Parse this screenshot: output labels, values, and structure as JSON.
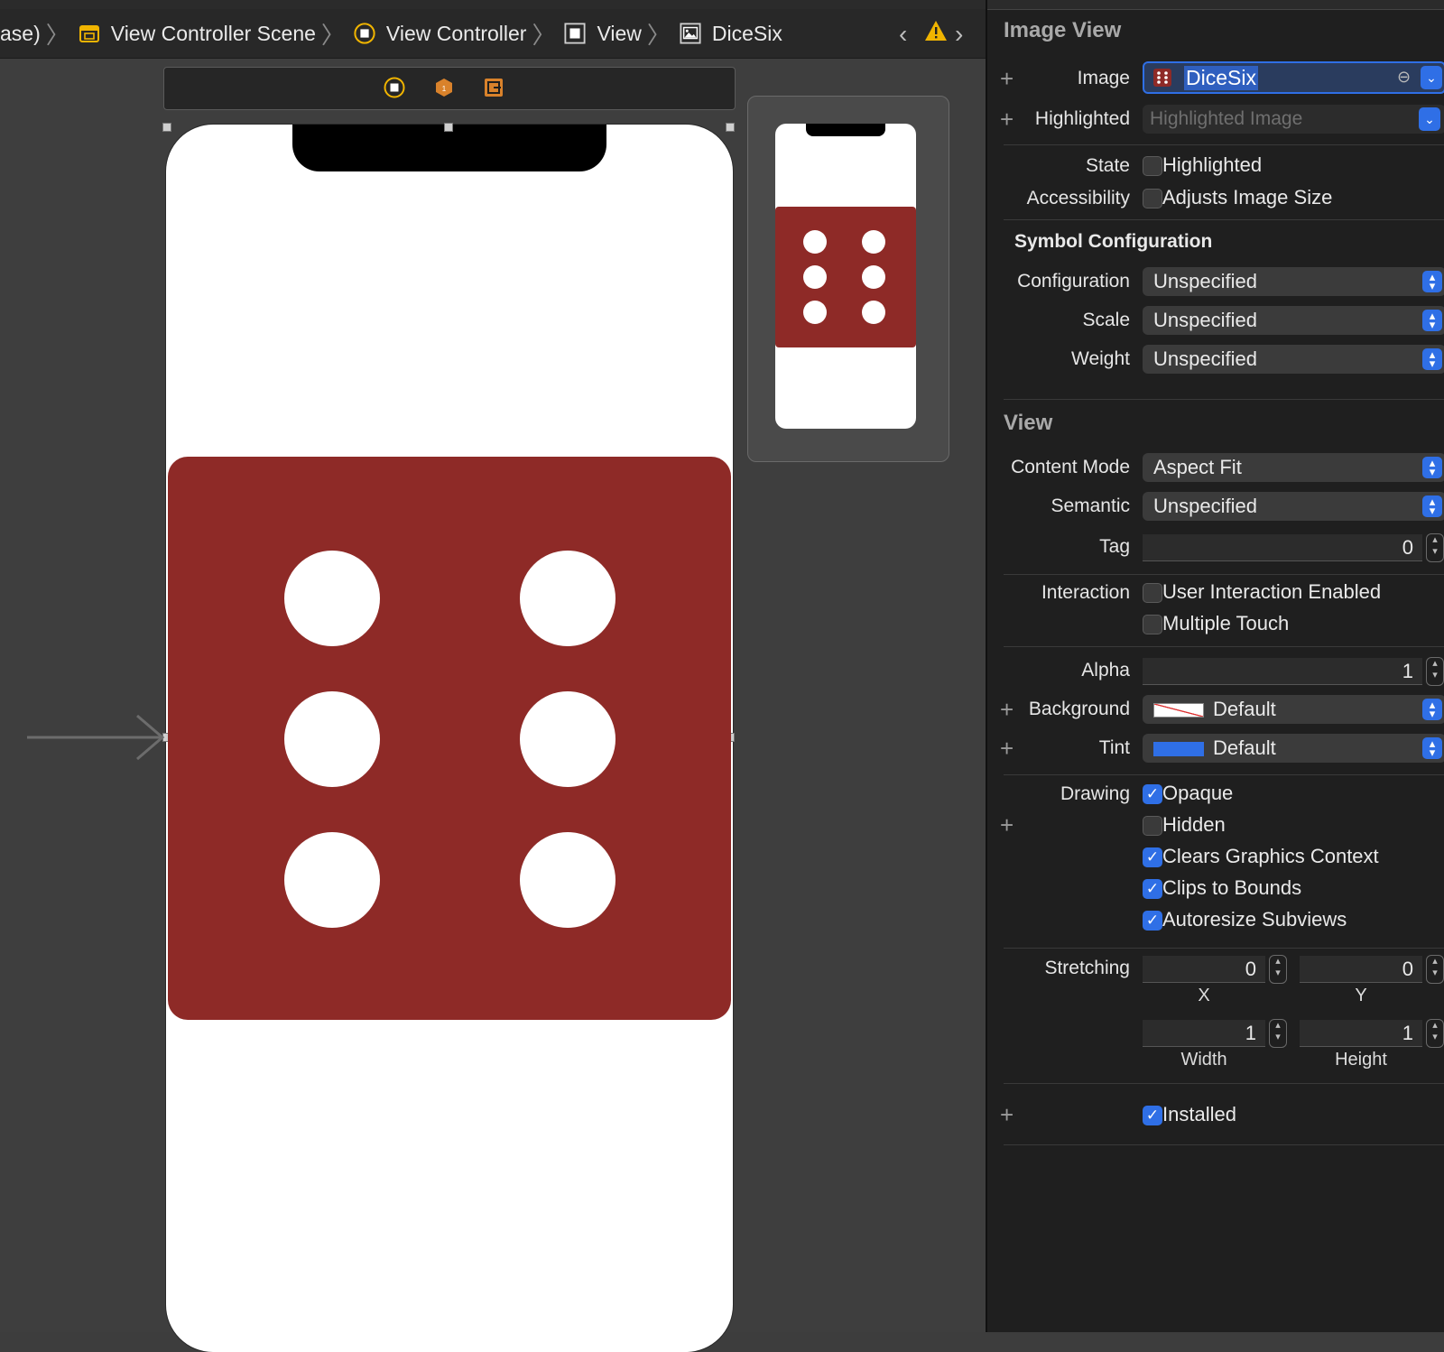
{
  "breadcrumbs": [
    {
      "label": "ase)",
      "icon": "none"
    },
    {
      "label": "View Controller Scene",
      "icon": "scene-icon"
    },
    {
      "label": "View Controller",
      "icon": "view-controller-icon"
    },
    {
      "label": "View",
      "icon": "view-icon"
    },
    {
      "label": "DiceSix",
      "icon": "image-view-icon"
    }
  ],
  "nav": {
    "back": "‹",
    "forward": "›",
    "warning": "!"
  },
  "canvas": {
    "dice_color": "#8e2a27",
    "pips": 6
  },
  "inspector": {
    "image_view_title": "Image View",
    "image_label": "Image",
    "image_value": "DiceSix",
    "highlighted_label": "Highlighted",
    "highlighted_placeholder": "Highlighted Image",
    "state_label": "State",
    "state_option": "Highlighted",
    "accessibility_label": "Accessibility",
    "accessibility_option": "Adjusts Image Size",
    "symbol_config_title": "Symbol Configuration",
    "configuration_label": "Configuration",
    "configuration_value": "Unspecified",
    "scale_label": "Scale",
    "scale_value": "Unspecified",
    "weight_label": "Weight",
    "weight_value": "Unspecified",
    "view_title": "View",
    "content_mode_label": "Content Mode",
    "content_mode_value": "Aspect Fit",
    "semantic_label": "Semantic",
    "semantic_value": "Unspecified",
    "tag_label": "Tag",
    "tag_value": "0",
    "interaction_label": "Interaction",
    "user_interaction": "User Interaction Enabled",
    "multiple_touch": "Multiple Touch",
    "alpha_label": "Alpha",
    "alpha_value": "1",
    "background_label": "Background",
    "background_value": "Default",
    "tint_label": "Tint",
    "tint_value": "Default",
    "tint_color": "#2f6fe6",
    "drawing_label": "Drawing",
    "opaque": "Opaque",
    "hidden": "Hidden",
    "clears_graphics": "Clears Graphics Context",
    "clips_bounds": "Clips to Bounds",
    "autoresize": "Autoresize Subviews",
    "stretching_label": "Stretching",
    "stretch_x": "0",
    "stretch_y": "0",
    "stretch_width": "1",
    "stretch_height": "1",
    "x_caption": "X",
    "y_caption": "Y",
    "width_caption": "Width",
    "height_caption": "Height",
    "installed": "Installed"
  }
}
